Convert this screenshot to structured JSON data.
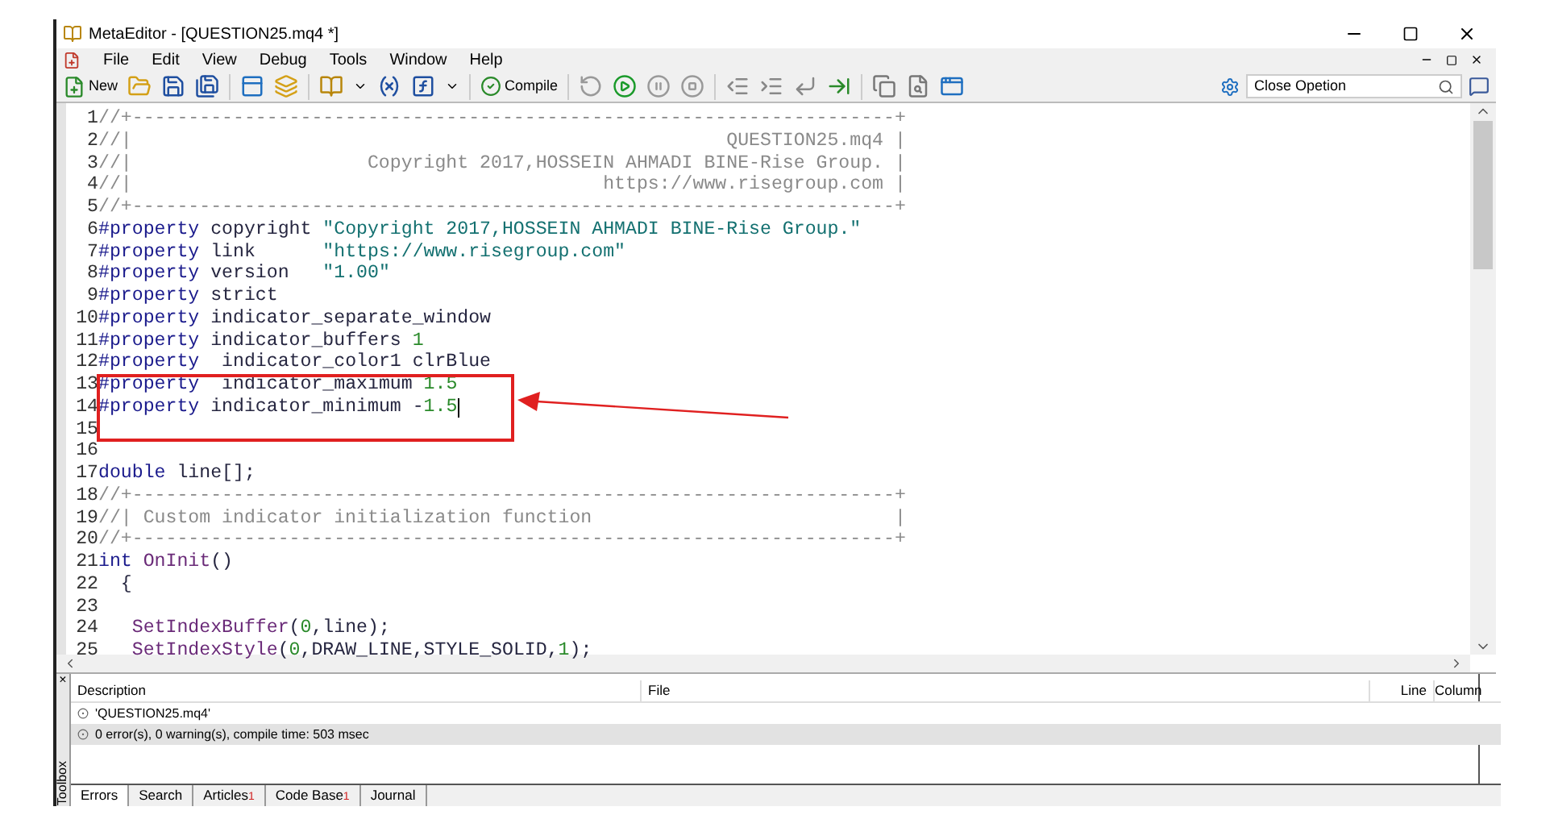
{
  "window": {
    "title": "MetaEditor - [QUESTION25.mq4 *]"
  },
  "menu": [
    {
      "label": "File"
    },
    {
      "label": "Edit"
    },
    {
      "label": "View"
    },
    {
      "label": "Debug"
    },
    {
      "label": "Tools"
    },
    {
      "label": "Window"
    },
    {
      "label": "Help"
    }
  ],
  "toolbar": {
    "new_label": "New",
    "compile_label": "Compile",
    "search": {
      "value": "Close Opetion"
    }
  },
  "editor": {
    "lines": [
      {
        "number": "1",
        "cursor": false,
        "segments": [
          {
            "kind": "comment",
            "text": "//+--------------------------------------------------------------------+"
          }
        ]
      },
      {
        "number": "2",
        "cursor": false,
        "segments": [
          {
            "kind": "comment",
            "text": "//|                                                     QUESTION25.mq4 |"
          }
        ]
      },
      {
        "number": "3",
        "cursor": false,
        "segments": [
          {
            "kind": "comment",
            "text": "//|                     Copyright 2017,HOSSEIN AHMADI BINE-Rise Group. |"
          }
        ]
      },
      {
        "number": "4",
        "cursor": false,
        "segments": [
          {
            "kind": "comment",
            "text": "//|                                          https://www.risegroup.com |"
          }
        ]
      },
      {
        "number": "5",
        "cursor": false,
        "segments": [
          {
            "kind": "comment",
            "text": "//+--------------------------------------------------------------------+"
          }
        ]
      },
      {
        "number": "6",
        "cursor": false,
        "segments": [
          {
            "kind": "keyword",
            "text": "#property"
          },
          {
            "kind": "plain",
            "text": " copyright "
          },
          {
            "kind": "string",
            "text": "\"Copyright 2017,HOSSEIN AHMADI BINE-Rise Group.\""
          }
        ]
      },
      {
        "number": "7",
        "cursor": false,
        "segments": [
          {
            "kind": "keyword",
            "text": "#property"
          },
          {
            "kind": "plain",
            "text": " link      "
          },
          {
            "kind": "string",
            "text": "\"https://www.risegroup.com\""
          }
        ]
      },
      {
        "number": "8",
        "cursor": false,
        "segments": [
          {
            "kind": "keyword",
            "text": "#property"
          },
          {
            "kind": "plain",
            "text": " version   "
          },
          {
            "kind": "string",
            "text": "\"1.00\""
          }
        ]
      },
      {
        "number": "9",
        "cursor": false,
        "segments": [
          {
            "kind": "keyword",
            "text": "#property"
          },
          {
            "kind": "plain",
            "text": " strict"
          }
        ]
      },
      {
        "number": "10",
        "cursor": false,
        "segments": [
          {
            "kind": "keyword",
            "text": "#property"
          },
          {
            "kind": "plain",
            "text": " indicator_separate_window"
          }
        ]
      },
      {
        "number": "11",
        "cursor": false,
        "segments": [
          {
            "kind": "keyword",
            "text": "#property"
          },
          {
            "kind": "plain",
            "text": " indicator_buffers "
          },
          {
            "kind": "number",
            "text": "1"
          }
        ]
      },
      {
        "number": "12",
        "cursor": false,
        "segments": [
          {
            "kind": "keyword",
            "text": "#property"
          },
          {
            "kind": "plain",
            "text": "  indicator_color1 clrBlue"
          }
        ]
      },
      {
        "number": "13",
        "cursor": false,
        "segments": [
          {
            "kind": "keyword",
            "text": "#property"
          },
          {
            "kind": "plain",
            "text": "  indicator_maximum "
          },
          {
            "kind": "number",
            "text": "1.5"
          }
        ]
      },
      {
        "number": "14",
        "cursor": true,
        "segments": [
          {
            "kind": "keyword",
            "text": "#property"
          },
          {
            "kind": "plain",
            "text": " indicator_minimum -"
          },
          {
            "kind": "number",
            "text": "1.5"
          }
        ]
      },
      {
        "number": "15",
        "cursor": false
      },
      {
        "number": "16",
        "cursor": false
      },
      {
        "number": "17",
        "cursor": false,
        "segments": [
          {
            "kind": "keyword",
            "text": "double"
          },
          {
            "kind": "plain",
            "text": " line[];"
          }
        ]
      },
      {
        "number": "18",
        "cursor": false,
        "segments": [
          {
            "kind": "comment",
            "text": "//+--------------------------------------------------------------------+"
          }
        ]
      },
      {
        "number": "19",
        "cursor": false,
        "segments": [
          {
            "kind": "comment",
            "text": "//| Custom indicator initialization function                           |"
          }
        ]
      },
      {
        "number": "20",
        "cursor": false,
        "segments": [
          {
            "kind": "comment",
            "text": "//+--------------------------------------------------------------------+"
          }
        ]
      },
      {
        "number": "21",
        "cursor": false,
        "segments": [
          {
            "kind": "keyword",
            "text": "int"
          },
          {
            "kind": "function",
            "text": " OnInit"
          },
          {
            "kind": "plain",
            "text": "()"
          }
        ]
      },
      {
        "number": "22",
        "cursor": false,
        "segments": [
          {
            "kind": "plain",
            "text": "  {"
          }
        ]
      },
      {
        "number": "23",
        "cursor": false
      },
      {
        "number": "24",
        "cursor": false,
        "segments": [
          {
            "kind": "function",
            "text": "   SetIndexBuffer"
          },
          {
            "kind": "plain",
            "text": "("
          },
          {
            "kind": "number",
            "text": "0"
          },
          {
            "kind": "plain",
            "text": ",line);"
          }
        ]
      },
      {
        "number": "25",
        "cursor": false,
        "segments": [
          {
            "kind": "function",
            "text": "   SetIndexStyle"
          },
          {
            "kind": "plain",
            "text": "("
          },
          {
            "kind": "number",
            "text": "0"
          },
          {
            "kind": "plain",
            "text": ",DRAW_LINE,STYLE_SOLID,"
          },
          {
            "kind": "number",
            "text": "1"
          },
          {
            "kind": "plain",
            "text": ");"
          }
        ]
      }
    ]
  },
  "toolbox": {
    "title": "Toolbox",
    "close": "×",
    "columns": [
      "Description",
      "File",
      "Line",
      "Column"
    ],
    "rows": [
      {
        "description": "'QUESTION25.mq4'",
        "selected": false
      },
      {
        "description": "0 error(s), 0 warning(s), compile time: 503 msec",
        "selected": true
      }
    ],
    "tabs": [
      {
        "label": "Errors",
        "selected": true
      },
      {
        "label": "Search",
        "selected": false
      },
      {
        "label": "Articles",
        "badge": "1",
        "selected": false
      },
      {
        "label": "Code Base",
        "badge": "1",
        "selected": false
      },
      {
        "label": "Journal",
        "selected": false
      }
    ]
  }
}
